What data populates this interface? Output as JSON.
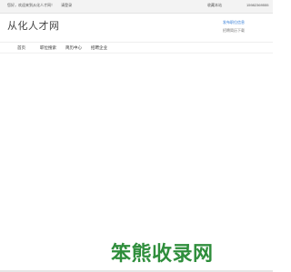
{
  "topbar": {
    "welcome_text": "您好，欢迎来到从化人才网！",
    "login_text": "请登录",
    "favorite_text": "收藏本站",
    "phone_text": "15982369555"
  },
  "header": {
    "site_name": "从化人才网",
    "post_job_link": "发布职位信息",
    "auxiliary_link": "招聘简历下载"
  },
  "nav": {
    "items": [
      "首页",
      "职位搜索",
      "简历中心",
      "招聘企业"
    ]
  },
  "watermark": {
    "text": "笨熊收录网"
  }
}
